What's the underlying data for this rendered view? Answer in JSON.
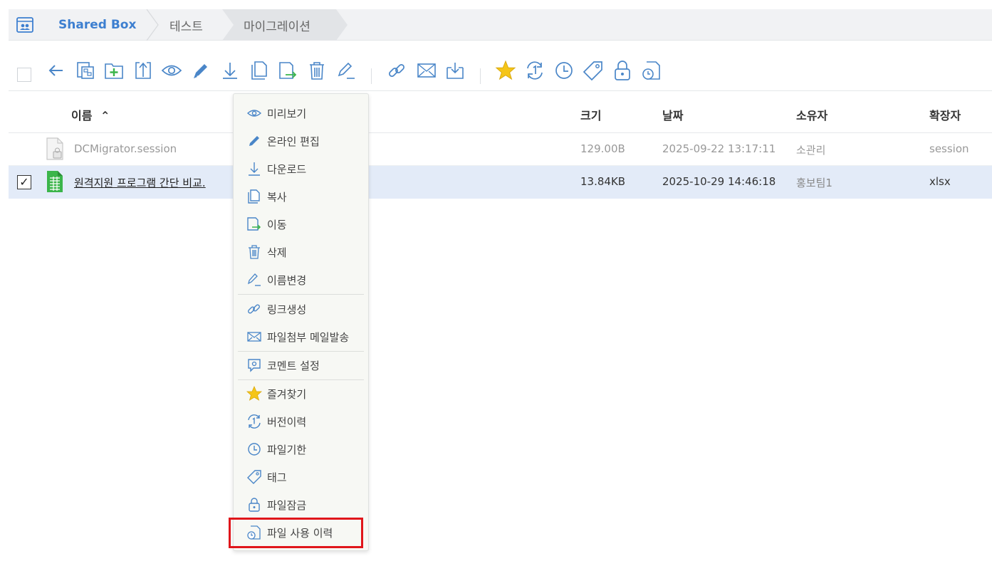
{
  "breadcrumb": {
    "root": "Shared Box",
    "items": [
      "테스트",
      "마이그레이션"
    ]
  },
  "toolbar": {
    "icons": [
      "back-arrow-icon",
      "copy-structure-icon",
      "new-folder-icon",
      "upload-icon",
      "preview-eye-icon",
      "edit-pencil-icon",
      "download-icon",
      "copy-icon",
      "move-icon",
      "trash-icon",
      "rename-icon",
      "link-icon",
      "mail-icon",
      "inbox-icon",
      "star-icon",
      "version-history-icon",
      "clock-icon",
      "tag-icon",
      "lock-icon",
      "file-history-icon"
    ]
  },
  "table": {
    "columns": {
      "name": "이름",
      "size": "크기",
      "date": "날짜",
      "owner": "소유자",
      "ext": "확장자"
    },
    "rows": [
      {
        "name": "DCMigrator.session",
        "size": "129.00B",
        "date": "2025-09-22 13:17:11",
        "owner": "소관리",
        "ext": "session",
        "selected": false
      },
      {
        "name": "원격지원 프로그램 간단 비교.",
        "size": "13.84KB",
        "date": "2025-10-29 14:46:18",
        "owner": "홍보팀1",
        "ext": "xlsx",
        "selected": true
      }
    ]
  },
  "context_menu": {
    "items": [
      {
        "label": "미리보기",
        "icon": "eye-icon"
      },
      {
        "label": "온라인 편집",
        "icon": "pencil-icon"
      },
      {
        "label": "다운로드",
        "icon": "download-icon"
      },
      {
        "label": "복사",
        "icon": "copy-icon"
      },
      {
        "label": "이동",
        "icon": "move-icon"
      },
      {
        "label": "삭제",
        "icon": "trash-icon"
      },
      {
        "label": "이름변경",
        "icon": "rename-icon"
      },
      {
        "label": "링크생성",
        "icon": "link-icon"
      },
      {
        "label": "파일첨부 메일발송",
        "icon": "mail-icon"
      },
      {
        "label": "코멘트 설정",
        "icon": "comment-icon"
      },
      {
        "label": "즐겨찾기",
        "icon": "star-icon"
      },
      {
        "label": "버전이력",
        "icon": "version-icon"
      },
      {
        "label": "파일기한",
        "icon": "clock-icon"
      },
      {
        "label": "태그",
        "icon": "tag-icon"
      },
      {
        "label": "파일잠금",
        "icon": "lock-icon"
      },
      {
        "label": "파일 사용 이력",
        "icon": "file-history-icon"
      }
    ]
  },
  "colors": {
    "accent": "#3d7fd0",
    "icon_blue": "#4a86c8",
    "selected_row": "#e3ebf8",
    "highlight_red": "#e0161b",
    "star": "#f5c518",
    "green": "#3bb54a"
  }
}
